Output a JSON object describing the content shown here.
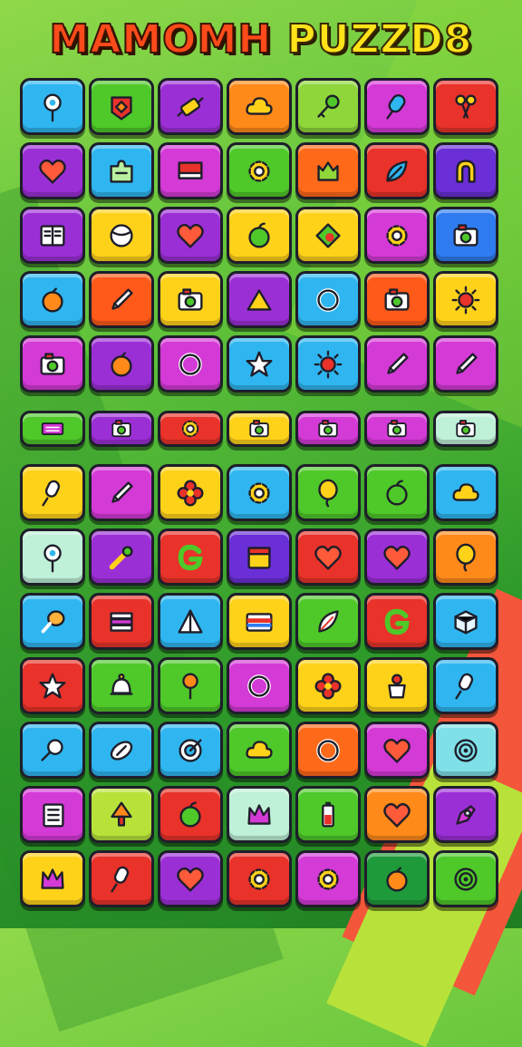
{
  "title": {
    "word1": "MAMOMH",
    "word2": "PUZZD8"
  },
  "rows": [
    [
      {
        "bg": "#2fb6f0",
        "icon": "pin-icon"
      },
      {
        "bg": "#4fc82a",
        "icon": "badge-icon"
      },
      {
        "bg": "#9b2fd6",
        "icon": "rolling-pin-icon"
      },
      {
        "bg": "#ff8a1a",
        "icon": "cloud-icon"
      },
      {
        "bg": "#8ed63a",
        "icon": "key-icon"
      },
      {
        "bg": "#d43ad6",
        "icon": "popsicle-icon"
      },
      {
        "bg": "#e8322a",
        "icon": "scissors-icon"
      }
    ],
    [
      {
        "bg": "#9b2fd6",
        "icon": "heart-icon"
      },
      {
        "bg": "#2fb6f0",
        "icon": "puzzle-icon"
      },
      {
        "bg": "#d43ad6",
        "icon": "flag-icon"
      },
      {
        "bg": "#4fc82a",
        "icon": "gear-icon"
      },
      {
        "bg": "#ff6a1a",
        "icon": "cat-icon"
      },
      {
        "bg": "#e8322a",
        "icon": "leaf-icon"
      },
      {
        "bg": "#6a2fd6",
        "icon": "magnet-icon"
      }
    ],
    [
      {
        "bg": "#9b2fd6",
        "icon": "book-icon"
      },
      {
        "bg": "#ffd21a",
        "icon": "ball-icon"
      },
      {
        "bg": "#9b2fd6",
        "icon": "heart-icon"
      },
      {
        "bg": "#ffd21a",
        "icon": "apple-icon"
      },
      {
        "bg": "#ffd21a",
        "icon": "diamond-icon"
      },
      {
        "bg": "#d43ad6",
        "icon": "gear-icon"
      },
      {
        "bg": "#2f7cf0",
        "icon": "camera-icon"
      }
    ],
    [
      {
        "bg": "#2fb6f0",
        "icon": "orange-icon"
      },
      {
        "bg": "#ff5a1a",
        "icon": "pencil-icon"
      },
      {
        "bg": "#ffd21a",
        "icon": "camera-icon"
      },
      {
        "bg": "#9b2fd6",
        "icon": "triangle-icon"
      },
      {
        "bg": "#2fb6f0",
        "icon": "ring-icon"
      },
      {
        "bg": "#ff5a1a",
        "icon": "camera-icon"
      },
      {
        "bg": "#ffd21a",
        "icon": "sun-icon"
      }
    ],
    [
      {
        "bg": "#d43ad6",
        "icon": "camera-icon"
      },
      {
        "bg": "#9b2fd6",
        "icon": "orange-icon"
      },
      {
        "bg": "#d43ad6",
        "icon": "ring-icon"
      },
      {
        "bg": "#2fb6f0",
        "icon": "star-icon"
      },
      {
        "bg": "#2fb6f0",
        "icon": "sun-icon"
      },
      {
        "bg": "#d43ad6",
        "icon": "pencil-icon"
      },
      {
        "bg": "#d43ad6",
        "icon": "pencil-icon"
      }
    ],
    [
      {
        "bg": "#4fc82a",
        "icon": "keyboard-icon",
        "thin": true
      },
      {
        "bg": "#9b2fd6",
        "icon": "camera-icon",
        "thin": true
      },
      {
        "bg": "#e8322a",
        "icon": "gear-icon",
        "thin": true
      },
      {
        "bg": "#ffd21a",
        "icon": "camera-icon",
        "thin": true
      },
      {
        "bg": "#d43ad6",
        "icon": "camera-icon",
        "thin": true
      },
      {
        "bg": "#d43ad6",
        "icon": "camera-icon",
        "thin": true
      },
      {
        "bg": "#bff0d8",
        "icon": "camera-icon",
        "thin": true
      }
    ],
    [
      {
        "bg": "#ffd21a",
        "icon": "microphone-icon"
      },
      {
        "bg": "#d43ad6",
        "icon": "pencil-icon"
      },
      {
        "bg": "#ffd21a",
        "icon": "flower-icon"
      },
      {
        "bg": "#2fb6f0",
        "icon": "gear-icon"
      },
      {
        "bg": "#4fc82a",
        "icon": "balloon-icon"
      },
      {
        "bg": "#4fc82a",
        "icon": "apple-icon"
      },
      {
        "bg": "#2fb6f0",
        "icon": "cloud-icon"
      }
    ],
    [
      {
        "bg": "#bff0d8",
        "icon": "pin-icon"
      },
      {
        "bg": "#9b2fd6",
        "icon": "wand-icon"
      },
      {
        "bg": "#e8322a",
        "icon": "letter-g-icon"
      },
      {
        "bg": "#6a2fd6",
        "icon": "calendar-icon"
      },
      {
        "bg": "#e8322a",
        "icon": "heart-icon"
      },
      {
        "bg": "#9b2fd6",
        "icon": "heart-icon"
      },
      {
        "bg": "#ff8a1a",
        "icon": "balloon-icon"
      }
    ],
    [
      {
        "bg": "#2fb6f0",
        "icon": "drumstick-icon"
      },
      {
        "bg": "#e8322a",
        "icon": "books-icon"
      },
      {
        "bg": "#2fb6f0",
        "icon": "tent-icon"
      },
      {
        "bg": "#ffd21a",
        "icon": "card-icon"
      },
      {
        "bg": "#4fc82a",
        "icon": "feather-icon"
      },
      {
        "bg": "#e8322a",
        "icon": "letter-g-icon"
      },
      {
        "bg": "#2fb6f0",
        "icon": "box-icon"
      }
    ],
    [
      {
        "bg": "#e8322a",
        "icon": "star-icon"
      },
      {
        "bg": "#4fc82a",
        "icon": "bell-icon"
      },
      {
        "bg": "#4fc82a",
        "icon": "pushpin-icon"
      },
      {
        "bg": "#d43ad6",
        "icon": "ring-icon"
      },
      {
        "bg": "#ffd21a",
        "icon": "flower-icon"
      },
      {
        "bg": "#ffd21a",
        "icon": "cupcake-icon"
      },
      {
        "bg": "#2fb6f0",
        "icon": "microphone-icon"
      }
    ],
    [
      {
        "bg": "#2fb6f0",
        "icon": "magnifier-icon"
      },
      {
        "bg": "#2fb6f0",
        "icon": "football-icon"
      },
      {
        "bg": "#2fb6f0",
        "icon": "target-icon"
      },
      {
        "bg": "#4fc82a",
        "icon": "cloud-icon"
      },
      {
        "bg": "#ff6a1a",
        "icon": "ring-icon"
      },
      {
        "bg": "#d43ad6",
        "icon": "heart-icon"
      },
      {
        "bg": "#7fe0e8",
        "icon": "spiral-icon"
      }
    ],
    [
      {
        "bg": "#d43ad6",
        "icon": "notepad-icon"
      },
      {
        "bg": "#b8e23a",
        "icon": "tree-icon"
      },
      {
        "bg": "#e8322a",
        "icon": "apple-icon"
      },
      {
        "bg": "#bff0d8",
        "icon": "crown-icon"
      },
      {
        "bg": "#4fc82a",
        "icon": "battery-icon"
      },
      {
        "bg": "#ff8a1a",
        "icon": "heart-icon"
      },
      {
        "bg": "#9b2fd6",
        "icon": "rocket-icon"
      }
    ],
    [
      {
        "bg": "#ffd21a",
        "icon": "crown-icon"
      },
      {
        "bg": "#e8322a",
        "icon": "microphone-icon"
      },
      {
        "bg": "#9b2fd6",
        "icon": "heart-icon"
      },
      {
        "bg": "#e8322a",
        "icon": "gear-icon"
      },
      {
        "bg": "#d43ad6",
        "icon": "gear-icon"
      },
      {
        "bg": "#1f9a3a",
        "icon": "orange-icon"
      },
      {
        "bg": "#4fc82a",
        "icon": "spiral-icon"
      }
    ]
  ]
}
